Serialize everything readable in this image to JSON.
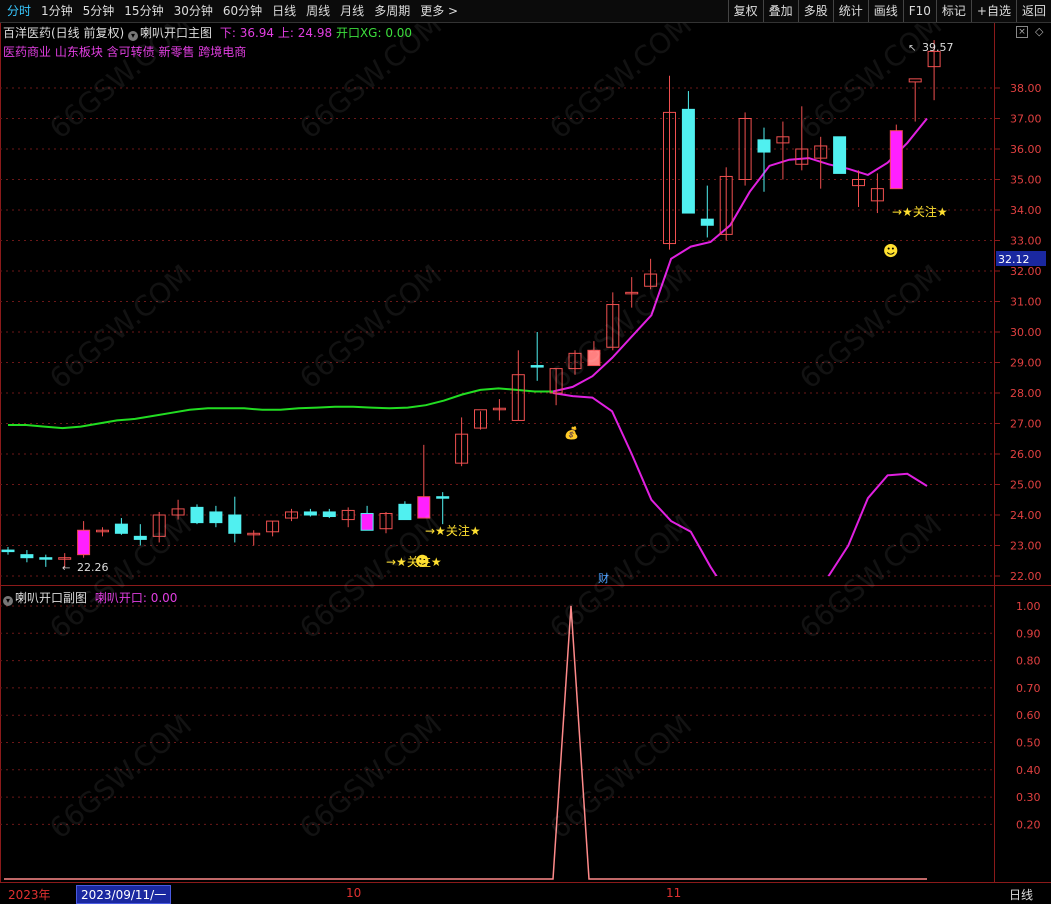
{
  "toolbar": {
    "tabs": [
      "分时",
      "1分钟",
      "5分钟",
      "15分钟",
      "30分钟",
      "60分钟",
      "日线",
      "周线",
      "月线",
      "多周期",
      "更多 >"
    ],
    "right_buttons": [
      "复权",
      "叠加",
      "多股",
      "统计",
      "画线",
      "F10",
      "标记",
      "+自选",
      "返回"
    ]
  },
  "info": {
    "stock_title": "百洋医药(日线 前复权)",
    "indicator_name": "喇叭开口主图",
    "lower_label": "下: 36.94",
    "upper_label": "上: 24.98",
    "xg_label": "开口XG: 0.00",
    "concepts": "医药商业 山东板块 含可转债 新零售 跨境电商"
  },
  "sub_info": {
    "name": "喇叭开口副图",
    "value_label": "喇叭开口: 0.00"
  },
  "annotations": {
    "max_price": "39.57",
    "min_price": "22.26",
    "attention": "→★关注★",
    "price_badge": "32.12",
    "cai": "财"
  },
  "bottom": {
    "year": "2023年",
    "date": "2023/09/11/一",
    "months": [
      "10",
      "11"
    ],
    "period": "日线"
  },
  "chart_data": [
    {
      "type": "candlestick",
      "title": "喇叭开口主图",
      "ylim": [
        21.7,
        39.8
      ],
      "yticks": [
        "22.00",
        "23.00",
        "24.00",
        "25.00",
        "26.00",
        "27.00",
        "28.00",
        "29.00",
        "30.00",
        "31.00",
        "32.00",
        "33.00",
        "34.00",
        "35.00",
        "36.00",
        "37.00",
        "38.00"
      ],
      "candles": [
        {
          "o": 22.85,
          "h": 22.95,
          "l": 22.7,
          "c": 22.8
        },
        {
          "o": 22.7,
          "h": 22.85,
          "l": 22.45,
          "c": 22.6
        },
        {
          "o": 22.6,
          "h": 22.7,
          "l": 22.3,
          "c": 22.55
        },
        {
          "o": 22.55,
          "h": 22.75,
          "l": 22.26,
          "c": 22.6
        },
        {
          "o": 22.7,
          "h": 23.8,
          "l": 22.6,
          "c": 23.5
        },
        {
          "o": 23.45,
          "h": 23.6,
          "l": 23.3,
          "c": 23.5
        },
        {
          "o": 23.7,
          "h": 23.9,
          "l": 23.35,
          "c": 23.4
        },
        {
          "o": 23.3,
          "h": 23.7,
          "l": 23.0,
          "c": 23.2
        },
        {
          "o": 23.3,
          "h": 24.1,
          "l": 23.1,
          "c": 24.0
        },
        {
          "o": 24.0,
          "h": 24.5,
          "l": 23.85,
          "c": 24.2
        },
        {
          "o": 24.25,
          "h": 24.35,
          "l": 23.7,
          "c": 23.75
        },
        {
          "o": 24.1,
          "h": 24.3,
          "l": 23.6,
          "c": 23.75
        },
        {
          "o": 24.0,
          "h": 24.6,
          "l": 23.1,
          "c": 23.4
        },
        {
          "o": 23.35,
          "h": 23.5,
          "l": 23.0,
          "c": 23.4
        },
        {
          "o": 23.45,
          "h": 23.8,
          "l": 23.3,
          "c": 23.8
        },
        {
          "o": 23.9,
          "h": 24.2,
          "l": 23.8,
          "c": 24.1
        },
        {
          "o": 24.1,
          "h": 24.2,
          "l": 23.95,
          "c": 24.0
        },
        {
          "o": 24.1,
          "h": 24.2,
          "l": 23.9,
          "c": 23.95
        },
        {
          "o": 23.85,
          "h": 24.25,
          "l": 23.6,
          "c": 24.15
        },
        {
          "o": 24.05,
          "h": 24.3,
          "l": 23.5,
          "c": 23.5
        },
        {
          "o": 23.55,
          "h": 24.1,
          "l": 23.4,
          "c": 24.05
        },
        {
          "o": 24.35,
          "h": 24.45,
          "l": 23.85,
          "c": 23.85
        },
        {
          "o": 23.9,
          "h": 26.3,
          "l": 23.9,
          "c": 24.6
        },
        {
          "o": 24.6,
          "h": 24.75,
          "l": 23.7,
          "c": 24.55
        },
        {
          "o": 25.7,
          "h": 27.2,
          "l": 25.6,
          "c": 26.65
        },
        {
          "o": 26.85,
          "h": 27.4,
          "l": 26.8,
          "c": 27.45
        },
        {
          "o": 27.45,
          "h": 27.8,
          "l": 27.1,
          "c": 27.5
        },
        {
          "o": 27.1,
          "h": 29.4,
          "l": 27.1,
          "c": 28.6
        },
        {
          "o": 28.9,
          "h": 30.0,
          "l": 28.4,
          "c": 28.85
        },
        {
          "o": 28.0,
          "h": 28.8,
          "l": 27.6,
          "c": 28.8
        },
        {
          "o": 28.8,
          "h": 29.4,
          "l": 28.6,
          "c": 29.3
        },
        {
          "o": 28.9,
          "h": 29.7,
          "l": 28.9,
          "c": 29.4
        },
        {
          "o": 29.5,
          "h": 31.3,
          "l": 29.4,
          "c": 30.9
        },
        {
          "o": 31.3,
          "h": 31.8,
          "l": 30.8,
          "c": 31.3
        },
        {
          "o": 31.5,
          "h": 32.4,
          "l": 31.4,
          "c": 31.9
        },
        {
          "o": 32.9,
          "h": 38.4,
          "l": 32.7,
          "c": 37.2
        },
        {
          "o": 37.3,
          "h": 37.9,
          "l": 34.0,
          "c": 33.9
        },
        {
          "o": 33.7,
          "h": 34.8,
          "l": 33.1,
          "c": 33.5
        },
        {
          "o": 33.2,
          "h": 35.4,
          "l": 33.0,
          "c": 35.1
        },
        {
          "o": 35.0,
          "h": 37.2,
          "l": 34.8,
          "c": 37.0
        },
        {
          "o": 36.3,
          "h": 36.7,
          "l": 34.6,
          "c": 35.9
        },
        {
          "o": 36.2,
          "h": 36.9,
          "l": 35.0,
          "c": 36.4
        },
        {
          "o": 35.5,
          "h": 37.4,
          "l": 35.3,
          "c": 36.0
        },
        {
          "o": 35.7,
          "h": 36.4,
          "l": 34.7,
          "c": 36.1
        },
        {
          "o": 36.4,
          "h": 36.4,
          "l": 35.2,
          "c": 35.2
        },
        {
          "o": 34.8,
          "h": 35.3,
          "l": 34.1,
          "c": 35.0
        },
        {
          "o": 34.3,
          "h": 35.2,
          "l": 33.9,
          "c": 34.7
        },
        {
          "o": 34.7,
          "h": 36.8,
          "l": 34.7,
          "c": 36.6
        },
        {
          "o": 38.2,
          "h": 38.2,
          "l": 36.9,
          "c": 38.3
        },
        {
          "o": 38.7,
          "h": 39.57,
          "l": 37.6,
          "c": 39.2
        }
      ],
      "green_line": [
        26.95,
        26.95,
        26.9,
        26.85,
        26.9,
        27.0,
        27.1,
        27.15,
        27.25,
        27.35,
        27.45,
        27.5,
        27.5,
        27.5,
        27.45,
        27.45,
        27.5,
        27.52,
        27.55,
        27.55,
        27.52,
        27.5,
        27.52,
        27.6,
        27.75,
        27.95,
        28.1,
        28.15,
        28.1,
        28.05,
        28.05
      ],
      "magenta_upper": [
        28.05,
        28.2,
        28.55,
        29.15,
        29.85,
        30.55,
        32.4,
        32.8,
        32.95,
        33.5,
        34.6,
        35.45,
        35.65,
        35.7,
        35.5,
        35.35,
        35.15,
        35.55,
        36.2,
        37.0
      ],
      "magenta_lower": [
        28.0,
        27.9,
        27.85,
        27.4,
        26.0,
        24.5,
        23.8,
        23.45,
        22.3,
        21.3,
        21.2,
        21.3,
        21.2,
        21.0,
        22.0,
        23.0,
        24.55,
        25.3,
        25.35,
        24.95
      ]
    },
    {
      "type": "line",
      "title": "喇叭开口副图",
      "ylim": [
        0,
        1.05
      ],
      "yticks": [
        "0.20",
        "0.30",
        "0.40",
        "0.50",
        "0.60",
        "0.70",
        "0.80",
        "0.90",
        "1.00"
      ],
      "values": [
        0,
        0,
        0,
        0,
        0,
        0,
        0,
        0,
        0,
        0,
        0,
        0,
        0,
        0,
        0,
        0,
        0,
        0,
        0,
        0,
        0,
        0,
        0,
        0,
        0,
        0,
        0,
        0,
        0,
        0,
        1,
        0,
        0,
        0,
        0,
        0,
        0,
        0,
        0,
        0,
        0,
        0,
        0,
        0,
        0,
        0,
        0,
        0,
        0,
        0
      ]
    }
  ]
}
